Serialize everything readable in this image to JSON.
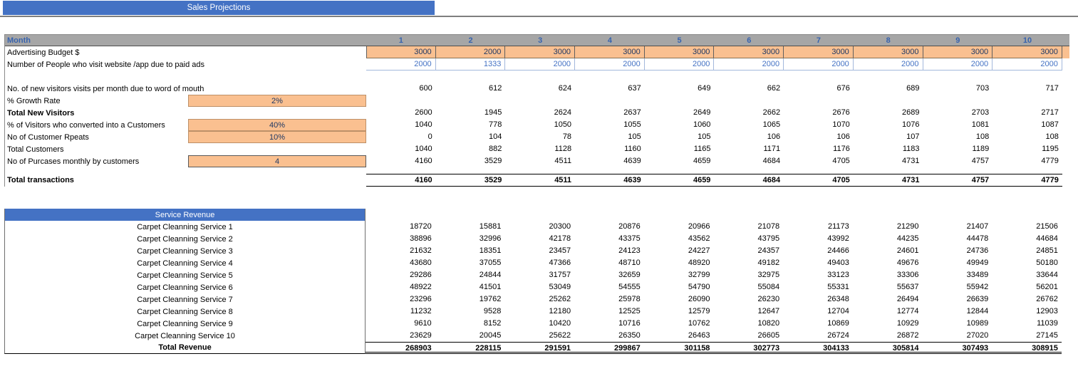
{
  "title_bar": {
    "label": "Sales Projections"
  },
  "colors": {
    "accent_blue": "#4472C4",
    "header_gray": "#A6A6A6",
    "input_orange": "#FAC090",
    "navy_value_text": "#1F3864",
    "blue_value_text": "#4472C4"
  },
  "table": {
    "month_header": {
      "label": "Month",
      "columns": [
        "1",
        "2",
        "3",
        "4",
        "5",
        "6",
        "7",
        "8",
        "9",
        "10"
      ]
    },
    "rows": [
      {
        "id": "advertising-budget",
        "label": "Advertising Budget $",
        "style": "orange",
        "editable": true,
        "values": [
          "3000",
          "2000",
          "3000",
          "3000",
          "3000",
          "3000",
          "3000",
          "3000",
          "3000",
          "3000"
        ]
      },
      {
        "id": "paid-ads-visitors",
        "label": "Number of People who visit website /app due to paid ads",
        "style": "blue",
        "values": [
          "2000",
          "1333",
          "2000",
          "2000",
          "2000",
          "2000",
          "2000",
          "2000",
          "2000",
          "2000"
        ]
      },
      {
        "id": "spacer-1",
        "style": "spacer"
      },
      {
        "id": "word-of-mouth-visitors",
        "label": "No. of new visitors visits per month due to word of mouth",
        "style": "plain",
        "values": [
          "600",
          "612",
          "624",
          "637",
          "649",
          "662",
          "676",
          "689",
          "703",
          "717"
        ]
      },
      {
        "id": "growth-rate",
        "label": "% Growth Rate",
        "style": "input",
        "input": "2%",
        "values": [
          "",
          "",
          "",
          "",
          "",
          "",
          "",
          "",
          "",
          ""
        ]
      },
      {
        "id": "total-new-visitors",
        "label": "Total New Visitors",
        "style": "plain",
        "bold_label": true,
        "values": [
          "2600",
          "1945",
          "2624",
          "2637",
          "2649",
          "2662",
          "2676",
          "2689",
          "2703",
          "2717"
        ]
      },
      {
        "id": "visitor-conversion-rate",
        "label": "% of Visitors who converted into a Customers",
        "style": "input",
        "input": "40%",
        "values": [
          "1040",
          "778",
          "1050",
          "1055",
          "1060",
          "1065",
          "1070",
          "1076",
          "1081",
          "1087"
        ]
      },
      {
        "id": "customer-repeats",
        "label": "No of Customer Rpeats",
        "style": "input",
        "input": "10%",
        "values": [
          "0",
          "104",
          "78",
          "105",
          "105",
          "106",
          "106",
          "107",
          "108",
          "108"
        ]
      },
      {
        "id": "total-customers",
        "label": "Total Customers",
        "style": "plain",
        "values": [
          "1040",
          "882",
          "1128",
          "1160",
          "1165",
          "1171",
          "1176",
          "1183",
          "1189",
          "1195"
        ]
      },
      {
        "id": "monthly-purchases",
        "label": "No of Purcases monthly by customers",
        "style": "input",
        "input": "4",
        "input_dark": true,
        "values": [
          "4160",
          "3529",
          "4511",
          "4639",
          "4659",
          "4684",
          "4705",
          "4731",
          "4757",
          "4779"
        ]
      },
      {
        "id": "spacer-2",
        "style": "spacer-small"
      },
      {
        "id": "total-transactions",
        "label": "Total transactions",
        "style": "total",
        "values": [
          "4160",
          "3529",
          "4511",
          "4639",
          "4659",
          "4684",
          "4705",
          "4731",
          "4757",
          "4779"
        ]
      }
    ]
  },
  "revenue": {
    "header": "Service Revenue",
    "rows": [
      {
        "label": "Carpet Cleanning Service 1",
        "values": [
          "18720",
          "15881",
          "20300",
          "20876",
          "20966",
          "21078",
          "21173",
          "21290",
          "21407",
          "21506"
        ]
      },
      {
        "label": "Carpet Cleanning Service 2",
        "values": [
          "38896",
          "32996",
          "42178",
          "43375",
          "43562",
          "43795",
          "43992",
          "44235",
          "44478",
          "44684"
        ]
      },
      {
        "label": "Carpet Cleanning Service 3",
        "values": [
          "21632",
          "18351",
          "23457",
          "24123",
          "24227",
          "24357",
          "24466",
          "24601",
          "24736",
          "24851"
        ]
      },
      {
        "label": "Carpet Cleanning Service 4",
        "values": [
          "43680",
          "37055",
          "47366",
          "48710",
          "48920",
          "49182",
          "49403",
          "49676",
          "49949",
          "50180"
        ]
      },
      {
        "label": "Carpet Cleanning Service 5",
        "values": [
          "29286",
          "24844",
          "31757",
          "32659",
          "32799",
          "32975",
          "33123",
          "33306",
          "33489",
          "33644"
        ]
      },
      {
        "label": "Carpet Cleanning Service 6",
        "values": [
          "48922",
          "41501",
          "53049",
          "54555",
          "54790",
          "55084",
          "55331",
          "55637",
          "55942",
          "56201"
        ]
      },
      {
        "label": "Carpet Cleanning Service 7",
        "values": [
          "23296",
          "19762",
          "25262",
          "25978",
          "26090",
          "26230",
          "26348",
          "26494",
          "26639",
          "26762"
        ]
      },
      {
        "label": "Carpet Cleanning Service 8",
        "values": [
          "11232",
          "9528",
          "12180",
          "12525",
          "12579",
          "12647",
          "12704",
          "12774",
          "12844",
          "12903"
        ]
      },
      {
        "label": "Carpet Cleanning Service 9",
        "values": [
          "9610",
          "8152",
          "10420",
          "10716",
          "10762",
          "10820",
          "10869",
          "10929",
          "10989",
          "11039"
        ]
      },
      {
        "label": "Carpet Cleanning Service 10",
        "values": [
          "23629",
          "20045",
          "25622",
          "26350",
          "26463",
          "26605",
          "26724",
          "26872",
          "27020",
          "27145"
        ]
      }
    ],
    "total": {
      "label": "Total Revenue",
      "values": [
        "268903",
        "228115",
        "291591",
        "299867",
        "301158",
        "302773",
        "304133",
        "305814",
        "307493",
        "308915"
      ]
    }
  }
}
